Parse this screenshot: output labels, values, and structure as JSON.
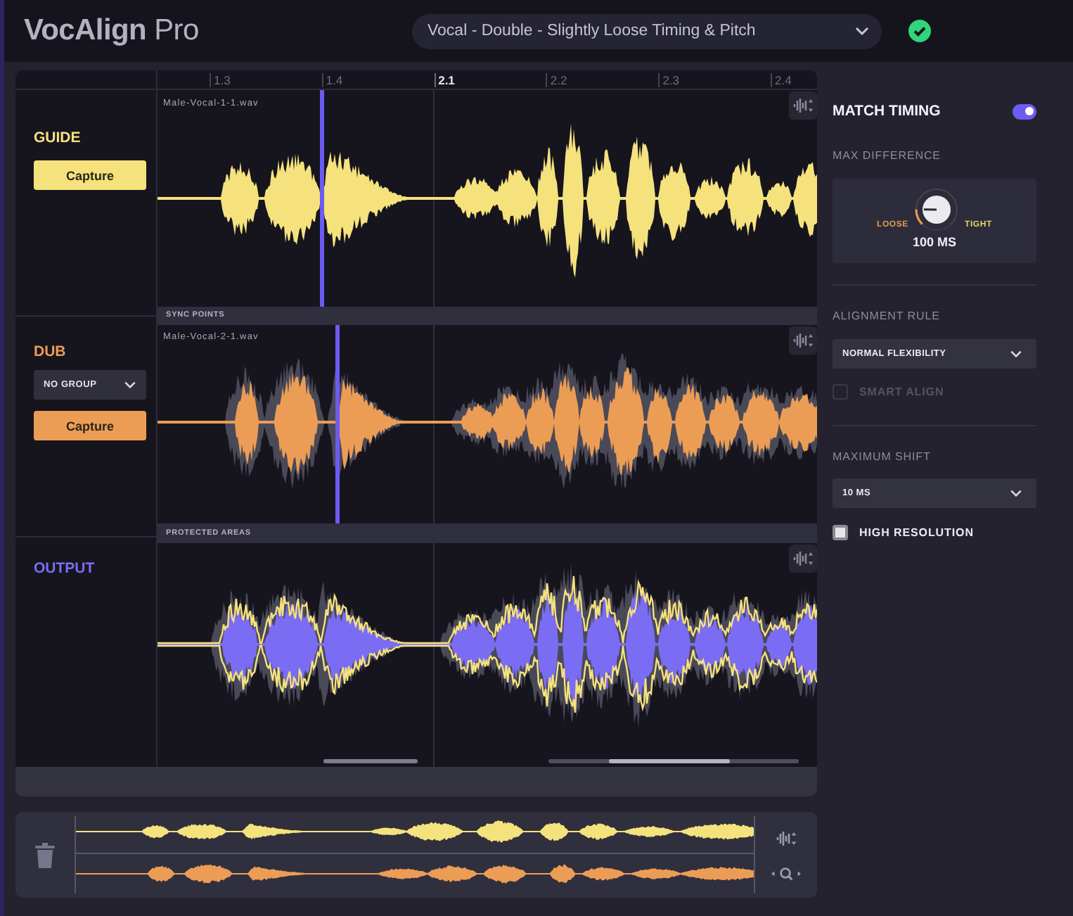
{
  "header": {
    "logo": "**VocAlign** Pro",
    "preset": "Vocal - Double - Slightly Loose Timing & Pitch"
  },
  "ruler": [
    {
      "label": "1.3",
      "kind": "minor"
    },
    {
      "label": "1.4",
      "kind": "minor"
    },
    {
      "label": "2.1",
      "kind": "major"
    },
    {
      "label": "2.2",
      "kind": "minor"
    },
    {
      "label": "2.3",
      "kind": "minor"
    },
    {
      "label": "2.4",
      "kind": "minor"
    }
  ],
  "tracks": [
    {
      "kind": "guide",
      "title": "GUIDE",
      "color": "#f5e27c",
      "capture": "Capture",
      "file": "Male-Vocal-1-1.wav",
      "lane_label": "SYNC POINTS"
    },
    {
      "kind": "dub",
      "title": "DUB",
      "color": "#ec9d55",
      "group": "NO GROUP",
      "capture": "Capture",
      "file": "Male-Vocal-2-1.wav",
      "lane_label": "PROTECTED AREAS"
    },
    {
      "kind": "output",
      "title": "OUTPUT",
      "color": "#7b6cf4"
    }
  ],
  "settings": {
    "match_timing": {
      "label": "MATCH TIMING",
      "on": true
    },
    "max_difference": {
      "label": "MAX DIFFERENCE",
      "loose": "LOOSE",
      "tight": "TIGHT",
      "value": "100 MS",
      "level": 0.17
    },
    "alignment_rule": {
      "label": "ALIGNMENT RULE",
      "value": "NORMAL FLEXIBILITY"
    },
    "smart_align": {
      "label": "SMART ALIGN",
      "checked": false,
      "disabled": true
    },
    "maximum_shift": {
      "label": "MAXIMUM SHIFT",
      "value": "10 MS"
    },
    "high_resolution": {
      "label": "HIGH RESOLUTION",
      "checked": true
    }
  }
}
